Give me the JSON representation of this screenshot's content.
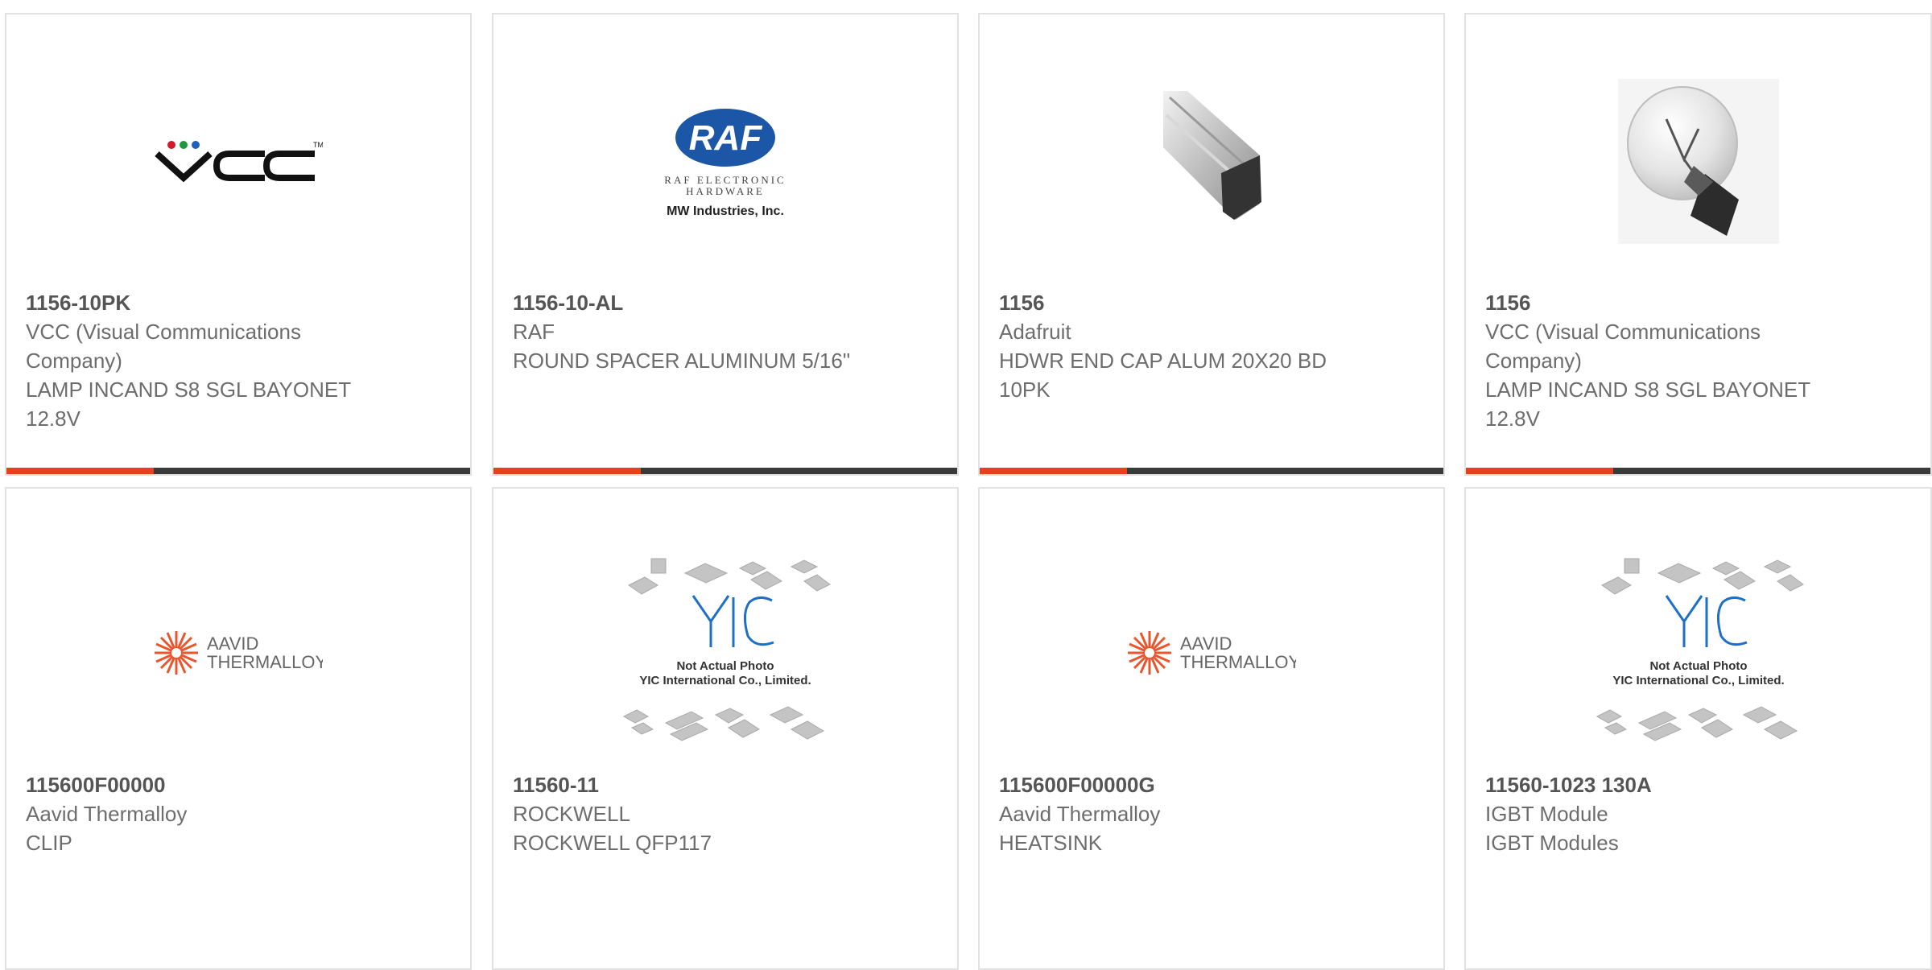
{
  "theme": {
    "accent": "#e8401c",
    "bar": "#3a3a3a"
  },
  "products": [
    {
      "part": "1156-10PK",
      "maker": "VCC (Visual Communications Company)",
      "desc": "LAMP INCAND S8 SGL BAYONET 12.8V",
      "image": "vcc-logo"
    },
    {
      "part": "1156-10-AL",
      "maker": "RAF",
      "desc": "ROUND SPACER ALUMINUM 5/16\"",
      "image": "raf-logo",
      "logo": {
        "mark": "RAF",
        "line1": "RAF ELECTRONIC",
        "line2": "HARDWARE",
        "line3": "MW Industries, Inc."
      }
    },
    {
      "part": "1156",
      "maker": "Adafruit",
      "desc": "HDWR END CAP ALUM 20X20 BD 10PK",
      "image": "aluminum-extrusion-photo"
    },
    {
      "part": "1156",
      "maker": "VCC (Visual Communications Company)",
      "desc": "LAMP INCAND S8 SGL BAYONET 12.8V",
      "image": "bulb-photo"
    },
    {
      "part": "115600F00000",
      "maker": "Aavid Thermalloy",
      "desc": "CLIP",
      "image": "aavid-logo",
      "logo": {
        "line1": "AAVID",
        "line2": "THERMALLOY"
      }
    },
    {
      "part": "11560-11",
      "maker": "ROCKWELL",
      "desc": "ROCKWELL QFP117",
      "image": "yic-placeholder",
      "logo": {
        "line1": "Not Actual Photo",
        "line2": "YIC International Co., Limited."
      }
    },
    {
      "part": "115600F00000G",
      "maker": "Aavid Thermalloy",
      "desc": "HEATSINK",
      "image": "aavid-logo",
      "logo": {
        "line1": "AAVID",
        "line2": "THERMALLOY"
      }
    },
    {
      "part": "11560-1023 130A",
      "maker": "IGBT Module",
      "desc": "IGBT Modules",
      "image": "yic-placeholder",
      "logo": {
        "line1": "Not Actual Photo",
        "line2": "YIC International Co., Limited."
      }
    }
  ]
}
